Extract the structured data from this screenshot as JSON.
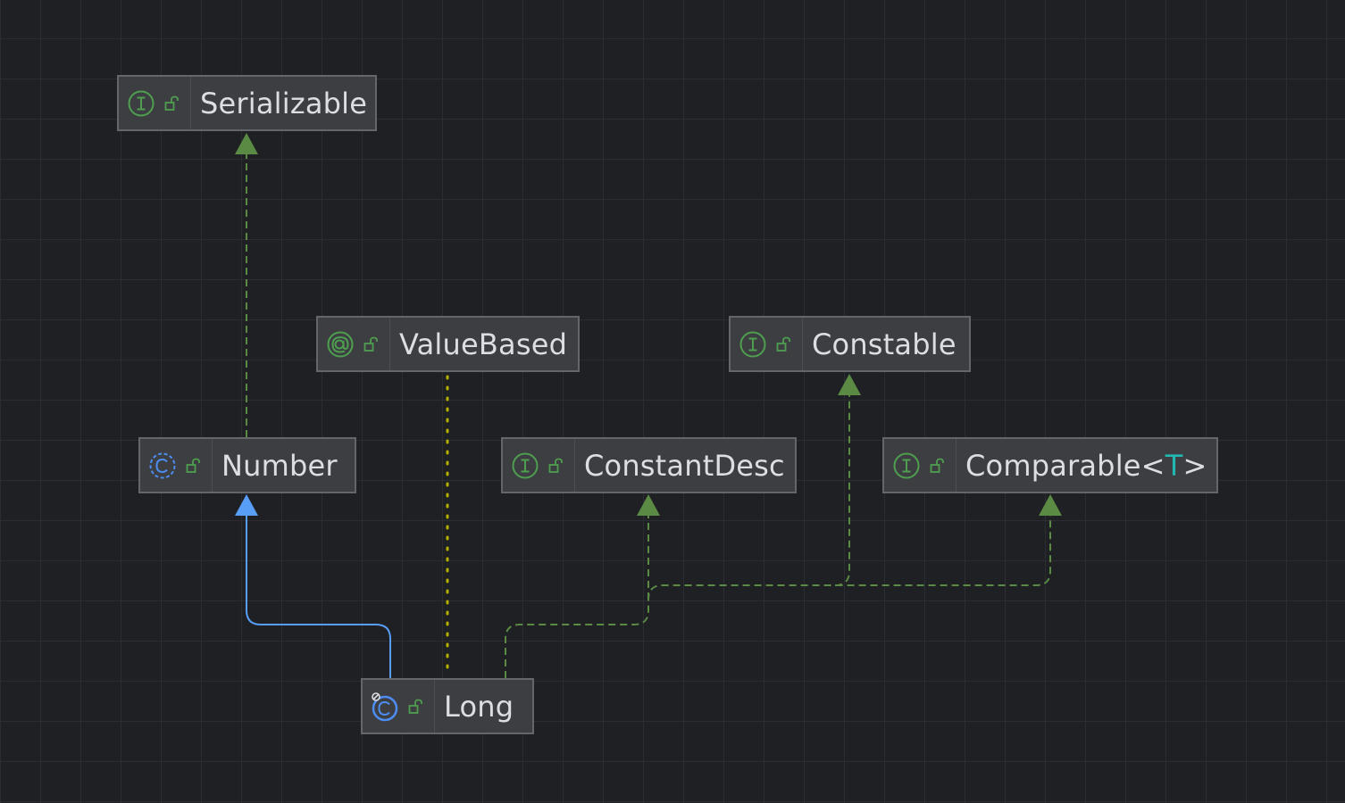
{
  "diagram": {
    "nodes": [
      {
        "id": "serializable",
        "label": "Serializable",
        "kind": "interface",
        "access": "public"
      },
      {
        "id": "valuebased",
        "label": "ValueBased",
        "kind": "annotation",
        "access": "public"
      },
      {
        "id": "constable",
        "label": "Constable",
        "kind": "interface",
        "access": "public"
      },
      {
        "id": "number",
        "label": "Number",
        "kind": "abstract-class",
        "access": "public"
      },
      {
        "id": "constantdesc",
        "label": "ConstantDesc",
        "kind": "interface",
        "access": "public"
      },
      {
        "id": "comparable",
        "label": "Comparable<",
        "type_param": "T",
        "label_suffix": ">",
        "kind": "interface",
        "access": "public"
      },
      {
        "id": "long",
        "label": "Long",
        "kind": "final-class",
        "access": "public"
      }
    ],
    "edges": [
      {
        "from": "number",
        "to": "serializable",
        "type": "implements"
      },
      {
        "from": "long",
        "to": "number",
        "type": "extends"
      },
      {
        "from": "long",
        "to": "valuebased",
        "type": "annotated-by"
      },
      {
        "from": "long",
        "to": "constantdesc",
        "type": "implements"
      },
      {
        "from": "long",
        "to": "constable",
        "type": "implements"
      },
      {
        "from": "long",
        "to": "comparable",
        "type": "implements"
      }
    ],
    "colors": {
      "background": "#1f2024",
      "grid": "#2b2d32",
      "node_fill": "#3c3e42",
      "node_border": "#63666b",
      "label_text": "#dcdee2",
      "type_param": "#22b7b0",
      "interface_icon": "#4f9e4f",
      "class_icon": "#4d8cf0",
      "extends_edge": "#589df6",
      "implements_edge": "#5a8a44",
      "annotation_edge": "#b5b000"
    },
    "icons": {
      "interface": "interface-icon",
      "annotation": "annotation-icon",
      "abstract-class": "abstract-class-icon",
      "final-class": "final-class-icon",
      "access": "unlocked-icon"
    }
  }
}
